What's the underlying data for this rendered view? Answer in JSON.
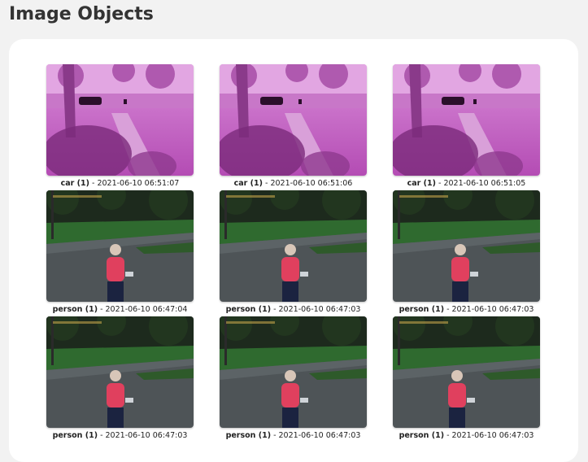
{
  "page": {
    "title": "Image Objects"
  },
  "objects": [
    {
      "label": "car (1)",
      "timestamp": "2021-06-10 06:51:07",
      "scene": "car"
    },
    {
      "label": "car (1)",
      "timestamp": "2021-06-10 06:51:06",
      "scene": "car"
    },
    {
      "label": "car (1)",
      "timestamp": "2021-06-10 06:51:05",
      "scene": "car"
    },
    {
      "label": "person (1)",
      "timestamp": "2021-06-10 06:47:04",
      "scene": "person"
    },
    {
      "label": "person (1)",
      "timestamp": "2021-06-10 06:47:03",
      "scene": "person"
    },
    {
      "label": "person (1)",
      "timestamp": "2021-06-10 06:47:03",
      "scene": "person"
    },
    {
      "label": "person (1)",
      "timestamp": "2021-06-10 06:47:03",
      "scene": "person"
    },
    {
      "label": "person (1)",
      "timestamp": "2021-06-10 06:47:03",
      "scene": "person"
    },
    {
      "label": "person (1)",
      "timestamp": "2021-06-10 06:47:03",
      "scene": "person"
    }
  ],
  "separator": " - ",
  "colors": {
    "background": "#f2f2f2",
    "panel": "#ffffff",
    "car_tint": "#c85ac8",
    "person_shirt": "#e0405e"
  }
}
